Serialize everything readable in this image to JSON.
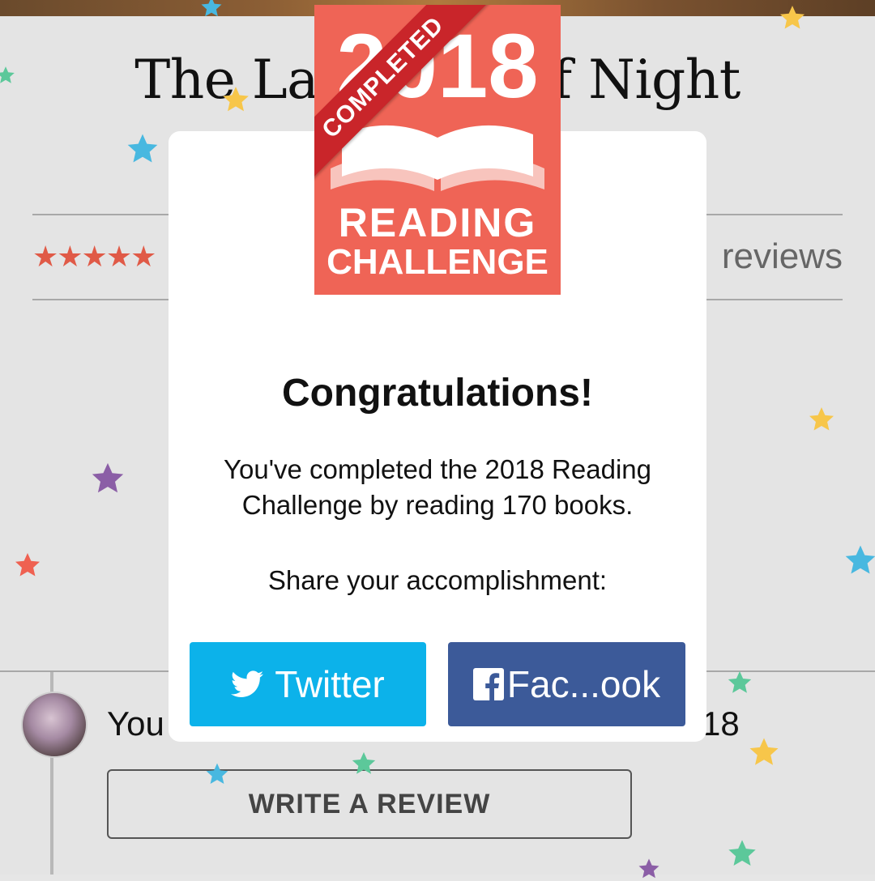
{
  "book": {
    "title": "The Last Ship of Night",
    "rating_stars": "★★★★★",
    "reviews_label": "reviews"
  },
  "shelf": {
    "status_left": "You",
    "status_right": "18",
    "write_review_label": "WRITE A REVIEW"
  },
  "badge": {
    "ribbon_label": "COMPLETED",
    "year": "2018",
    "line1": "READING",
    "line2": "CHALLENGE"
  },
  "dialog": {
    "heading": "Congratulations!",
    "message": "You've completed the 2018 Reading Challenge by reading 170 books.",
    "share_prompt": "Share your accomplishment:",
    "twitter_label": "Twitter",
    "facebook_label": "Fac...ook"
  },
  "colors": {
    "badge": "#ef6456",
    "ribbon": "#c9252a",
    "twitter": "#0cb2ea",
    "facebook": "#3c5a99",
    "rating": "#e05a47"
  },
  "icons": {
    "twitter": "twitter-bird-icon",
    "facebook": "facebook-f-icon",
    "confetti": "star-icon"
  }
}
